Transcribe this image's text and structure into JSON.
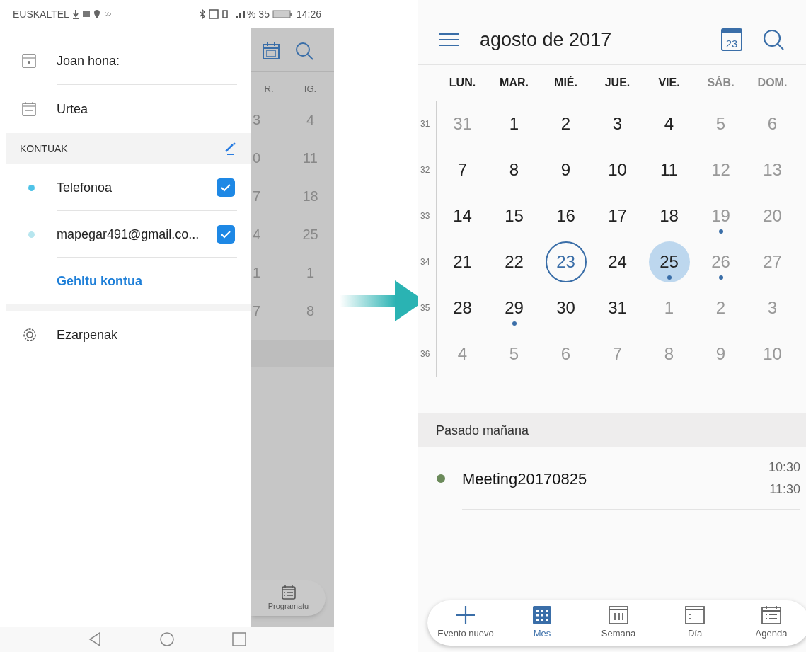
{
  "left_phone": {
    "status_bar": {
      "carrier": "EUSKALTEL",
      "battery": "% 35",
      "time": "14:26"
    },
    "drawer": {
      "items": [
        {
          "label": "Joan hona:",
          "kind": "goto"
        },
        {
          "label": "Urtea",
          "kind": "year"
        }
      ],
      "accounts_header": "KONTUAK",
      "accounts": [
        {
          "name": "Telefonoa",
          "color": "#4fc3e8",
          "checked": true
        },
        {
          "name": "mapegar491@gmail.co...",
          "color": "#b7e6ef",
          "checked": true
        }
      ],
      "add_account": "Gehitu kontua",
      "settings": "Ezarpenak"
    },
    "background": {
      "weekdays": [
        "R.",
        "IG."
      ],
      "rows": [
        [
          "3",
          "4"
        ],
        [
          "0",
          "11"
        ],
        [
          "7",
          "18"
        ],
        [
          "4",
          "25"
        ],
        [
          "1",
          "1"
        ],
        [
          "7",
          "8"
        ]
      ],
      "schedule_button": "Programatu"
    }
  },
  "right_phone": {
    "title": "agosto de 2017",
    "today_icon": "23",
    "weekdays": [
      {
        "label": "LUN.",
        "weekend": false
      },
      {
        "label": "MAR.",
        "weekend": false
      },
      {
        "label": "MIÉ.",
        "weekend": false
      },
      {
        "label": "JUE.",
        "weekend": false
      },
      {
        "label": "VIE.",
        "weekend": false
      },
      {
        "label": "SÁB.",
        "weekend": true
      },
      {
        "label": "DOM.",
        "weekend": true
      }
    ],
    "weeks": [
      {
        "number": "31",
        "days": [
          {
            "label": "31",
            "muted": true
          },
          {
            "label": "1",
            "muted": false
          },
          {
            "label": "2",
            "muted": false
          },
          {
            "label": "3",
            "muted": false
          },
          {
            "label": "4",
            "muted": false
          },
          {
            "label": "5",
            "muted": true
          },
          {
            "label": "6",
            "muted": true
          }
        ]
      },
      {
        "number": "32",
        "days": [
          {
            "label": "7",
            "muted": false
          },
          {
            "label": "8",
            "muted": false
          },
          {
            "label": "9",
            "muted": false
          },
          {
            "label": "10",
            "muted": false
          },
          {
            "label": "11",
            "muted": false
          },
          {
            "label": "12",
            "muted": true
          },
          {
            "label": "13",
            "muted": true
          }
        ]
      },
      {
        "number": "33",
        "days": [
          {
            "label": "14",
            "muted": false
          },
          {
            "label": "15",
            "muted": false
          },
          {
            "label": "16",
            "muted": false
          },
          {
            "label": "17",
            "muted": false
          },
          {
            "label": "18",
            "muted": false
          },
          {
            "label": "19",
            "muted": true,
            "event": true
          },
          {
            "label": "20",
            "muted": true
          }
        ]
      },
      {
        "number": "34",
        "days": [
          {
            "label": "21",
            "muted": false
          },
          {
            "label": "22",
            "muted": false
          },
          {
            "label": "23",
            "muted": false,
            "today": true
          },
          {
            "label": "24",
            "muted": false
          },
          {
            "label": "25",
            "muted": false,
            "selected": true,
            "event": true
          },
          {
            "label": "26",
            "muted": true,
            "event": true
          },
          {
            "label": "27",
            "muted": true
          }
        ]
      },
      {
        "number": "35",
        "days": [
          {
            "label": "28",
            "muted": false
          },
          {
            "label": "29",
            "muted": false,
            "event": true
          },
          {
            "label": "30",
            "muted": false
          },
          {
            "label": "31",
            "muted": false
          },
          {
            "label": "1",
            "muted": true
          },
          {
            "label": "2",
            "muted": true
          },
          {
            "label": "3",
            "muted": true
          }
        ]
      },
      {
        "number": "36",
        "days": [
          {
            "label": "4",
            "muted": true
          },
          {
            "label": "5",
            "muted": true
          },
          {
            "label": "6",
            "muted": true
          },
          {
            "label": "7",
            "muted": true
          },
          {
            "label": "8",
            "muted": true
          },
          {
            "label": "9",
            "muted": true
          },
          {
            "label": "10",
            "muted": true
          }
        ]
      }
    ],
    "agenda_header": "Pasado mañana",
    "events": [
      {
        "title": "Meeting20170825",
        "color": "#6b8a5a",
        "start": "10:30",
        "end": "11:30"
      }
    ],
    "bottom_nav": [
      {
        "label": "Evento nuevo",
        "kind": "add",
        "selected": false
      },
      {
        "label": "Mes",
        "kind": "month",
        "selected": true
      },
      {
        "label": "Semana",
        "kind": "week",
        "selected": false
      },
      {
        "label": "Día",
        "kind": "day",
        "selected": false
      },
      {
        "label": "Agenda",
        "kind": "agenda",
        "selected": false
      }
    ]
  }
}
